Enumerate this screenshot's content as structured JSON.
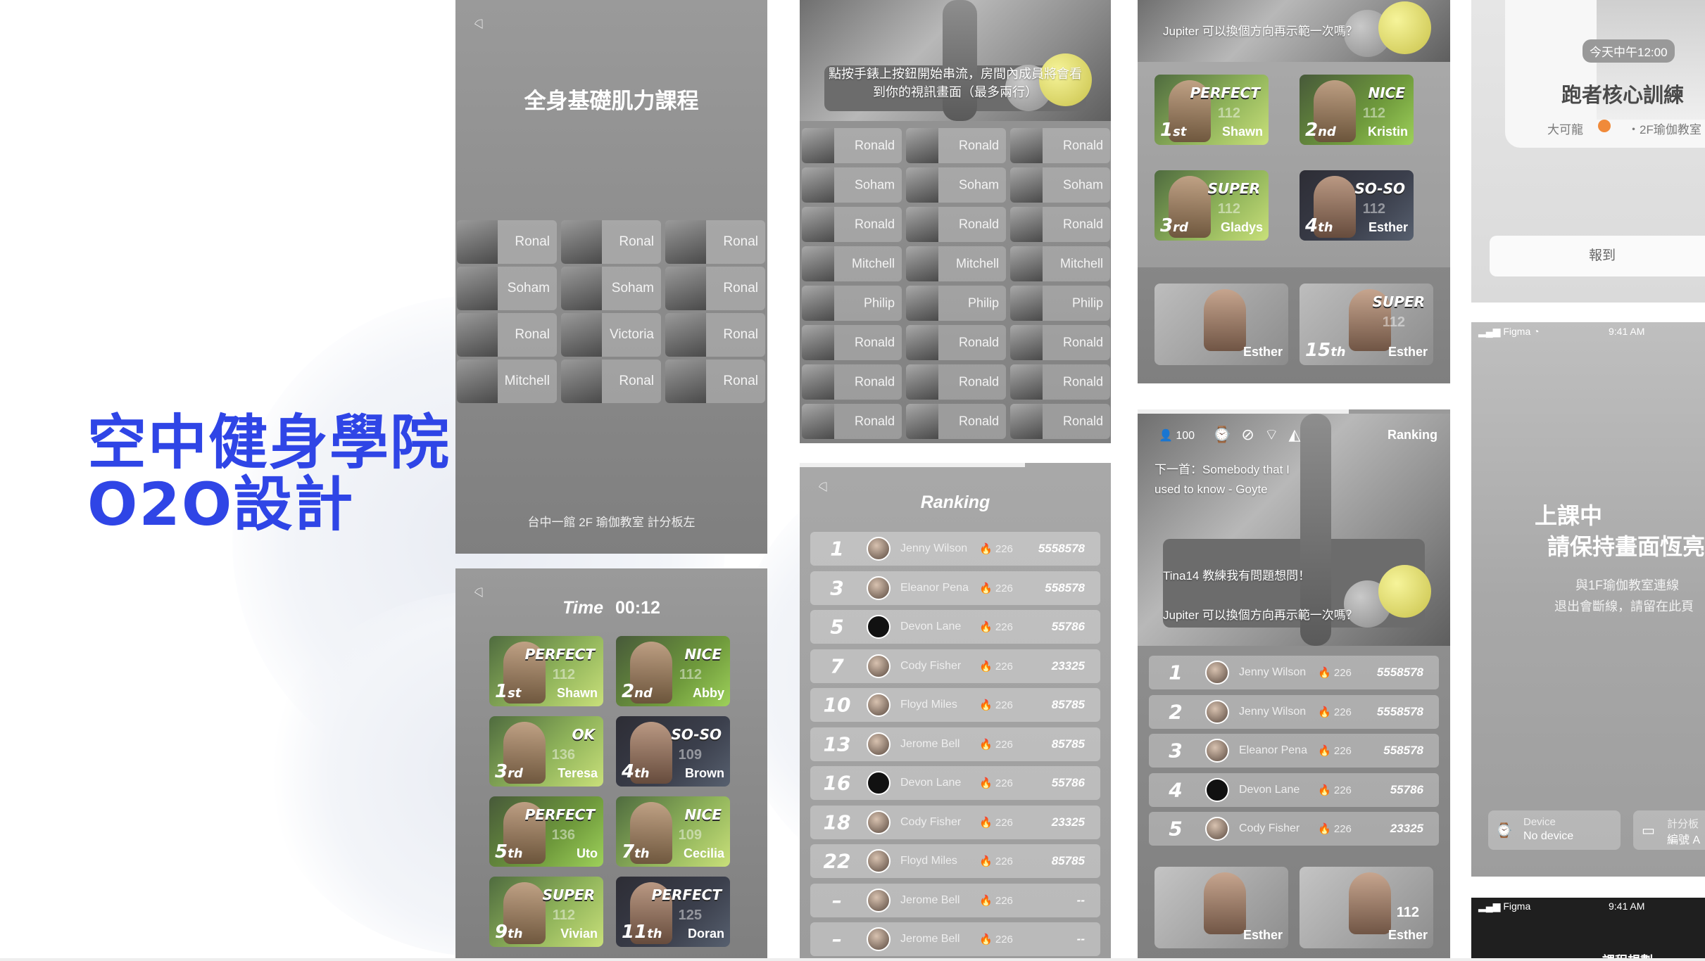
{
  "hero": {
    "line1": "空中健身學院",
    "line2": "O2O設計"
  },
  "panel_a": {
    "title": "全身基礎肌力課程",
    "footer": "台中一館 2F 瑜伽教室 計分板左",
    "tiles": [
      [
        "Ronal",
        "Ronal",
        "Ronal"
      ],
      [
        "Soham",
        "Soham",
        "Ronal"
      ],
      [
        "Ronal",
        "Victoria",
        "Ronal"
      ],
      [
        "Mitchell",
        "Ronal",
        "Ronal"
      ]
    ]
  },
  "panel_b": {
    "time_label": "Time",
    "time_value": "00:12",
    "cards": [
      {
        "badge": "PERFECT",
        "score": "112",
        "place": "1",
        "suffix": "st",
        "name": "Shawn"
      },
      {
        "badge": "NICE",
        "score": "112",
        "place": "2",
        "suffix": "nd",
        "name": "Abby"
      },
      {
        "badge": "OK",
        "score": "136",
        "place": "3",
        "suffix": "rd",
        "name": "Teresa"
      },
      {
        "badge": "SO-SO",
        "score": "109",
        "place": "4",
        "suffix": "th",
        "name": "Brown"
      },
      {
        "badge": "PERFECT",
        "score": "136",
        "place": "5",
        "suffix": "th",
        "name": "Uto"
      },
      {
        "badge": "NICE",
        "score": "109",
        "place": "7",
        "suffix": "th",
        "name": "Cecilia"
      },
      {
        "badge": "SUPER",
        "score": "112",
        "place": "9",
        "suffix": "th",
        "name": "Vivian"
      },
      {
        "badge": "PERFECT",
        "score": "125",
        "place": "11",
        "suffix": "th",
        "name": "Doran"
      }
    ]
  },
  "panel_c": {
    "caption_line1": "點按手錶上按鈕開始串流，房間內成員將會看",
    "caption_line2": "到你的視訊畫面（最多兩行）",
    "tiles": [
      [
        "Ronald",
        "Ronald",
        "Ronald"
      ],
      [
        "Soham",
        "Soham",
        "Soham"
      ],
      [
        "Ronald",
        "Ronald",
        "Ronald"
      ],
      [
        "Mitchell",
        "Mitchell",
        "Mitchell"
      ],
      [
        "Philip",
        "Philip",
        "Philip"
      ],
      [
        "Ronald",
        "Ronald",
        "Ronald"
      ],
      [
        "Ronald",
        "Ronald",
        "Ronald"
      ],
      [
        "Ronald",
        "Ronald",
        "Ronald"
      ]
    ]
  },
  "panel_d": {
    "title": "Ranking",
    "rows": [
      {
        "rank": "1",
        "name": "Jenny Wilson",
        "fire": "226",
        "score": "5558578",
        "black": false
      },
      {
        "rank": "3",
        "name": "Eleanor Pena",
        "fire": "226",
        "score": "558578",
        "black": false
      },
      {
        "rank": "5",
        "name": "Devon Lane",
        "fire": "226",
        "score": "55786",
        "black": true
      },
      {
        "rank": "7",
        "name": "Cody Fisher",
        "fire": "226",
        "score": "23325",
        "black": false
      },
      {
        "rank": "10",
        "name": "Floyd Miles",
        "fire": "226",
        "score": "85785",
        "black": false
      },
      {
        "rank": "13",
        "name": "Jerome Bell",
        "fire": "226",
        "score": "85785",
        "black": false
      },
      {
        "rank": "16",
        "name": "Devon Lane",
        "fire": "226",
        "score": "55786",
        "black": true
      },
      {
        "rank": "18",
        "name": "Cody Fisher",
        "fire": "226",
        "score": "23325",
        "black": false
      },
      {
        "rank": "22",
        "name": "Floyd Miles",
        "fire": "226",
        "score": "85785",
        "black": false
      },
      {
        "rank": "–",
        "name": "Jerome Bell",
        "fire": "226",
        "score": "--",
        "black": false
      },
      {
        "rank": "–",
        "name": "Jerome Bell",
        "fire": "226",
        "score": "--",
        "black": false
      }
    ]
  },
  "panel_e": {
    "question": "Jupiter  可以換個方向再示範一次嗎？",
    "cards": [
      {
        "badge": "PERFECT",
        "score": "112",
        "place": "1",
        "suffix": "st",
        "name": "Shawn"
      },
      {
        "badge": "NICE",
        "score": "112",
        "place": "2",
        "suffix": "nd",
        "name": "Kristin"
      },
      {
        "badge": "SUPER",
        "score": "112",
        "place": "3",
        "suffix": "rd",
        "name": "Gladys"
      },
      {
        "badge": "SO-SO",
        "score": "112",
        "place": "4",
        "suffix": "th",
        "name": "Esther"
      }
    ],
    "bottom_cards": [
      {
        "place": "",
        "suffix": "",
        "name": "Esther",
        "badge": ""
      },
      {
        "place": "15",
        "suffix": "th",
        "name": "Esther",
        "badge": "SUPER",
        "score": "112"
      }
    ]
  },
  "panel_f": {
    "count": "100",
    "ranking_label": "Ranking",
    "next_song_line1": "下一首：Somebody that I",
    "next_song_line2": "used to know - Goyte",
    "chat1": "Tina14  教練我有問題想問！",
    "chat2": "Jupiter  可以換個方向再示範一次嗎？",
    "rows": [
      {
        "rank": "1",
        "name": "Jenny Wilson",
        "fire": "226",
        "score": "5558578",
        "black": false
      },
      {
        "rank": "2",
        "name": "Jenny Wilson",
        "fire": "226",
        "score": "5558578",
        "black": false
      },
      {
        "rank": "3",
        "name": "Eleanor Pena",
        "fire": "226",
        "score": "558578",
        "black": false
      },
      {
        "rank": "4",
        "name": "Devon Lane",
        "fire": "226",
        "score": "55786",
        "black": true
      },
      {
        "rank": "5",
        "name": "Cody Fisher",
        "fire": "226",
        "score": "23325",
        "black": false
      }
    ],
    "bottom_cards": [
      {
        "name": "Esther",
        "score": ""
      },
      {
        "name": "Esther",
        "score": "112"
      }
    ]
  },
  "panel_g": {
    "time": "今天中午12:00",
    "course": "跑者核心訓練",
    "teacher": "大可龍",
    "location": "・2F瑜伽教室",
    "checkin": "報到"
  },
  "panel_h": {
    "carrier": "Figma",
    "clock": "9:41 AM",
    "title1": "上課中",
    "title2": "請保持畫面恆亮",
    "line1": "與1F瑜伽教室連線",
    "line2": "退出會斷線，請留在此頁",
    "device_label": "Device",
    "device_value": "No device",
    "score_label": "計分板",
    "score_value": "編號 A"
  },
  "panel_i": {
    "carrier": "Figma",
    "clock": "9:41 AM",
    "title": "課程規劃"
  },
  "colors": {
    "hero": "#2f45e6",
    "panel": "#8f8f8f"
  }
}
